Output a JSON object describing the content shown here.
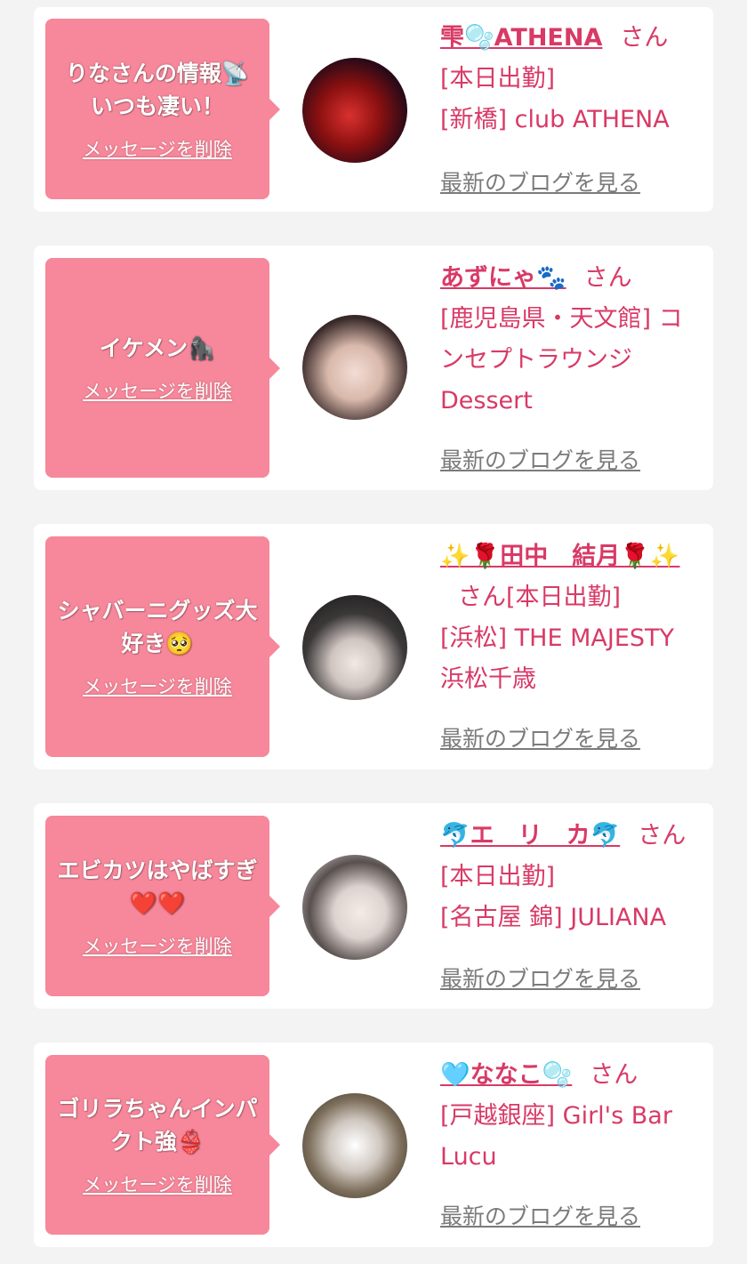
{
  "cards": [
    {
      "message": "りなさんの情報📡いつも凄い！",
      "delete_label": "メッセージを削除",
      "name": "雫🫧ATHENA",
      "san": "さん",
      "status": "[本日出勤]",
      "shop": "[新橋] club ATHENA",
      "blog_label": "最新のブログを見る"
    },
    {
      "message": "イケメン🦍",
      "delete_label": "メッセージを削除",
      "name": "あずにゃ🐾",
      "san": "さん",
      "status": "",
      "shop": "[鹿児島県・天文館] コンセプトラウンジDessert",
      "blog_label": "最新のブログを見る"
    },
    {
      "message": "シャバーニグッズ大好き🥺",
      "delete_label": "メッセージを削除",
      "name": "✨🌹田中　結月🌹✨",
      "san": "さん",
      "status": "[本日出勤]",
      "shop": "[浜松] THE MAJESTY 浜松千歳",
      "blog_label": "最新のブログを見る"
    },
    {
      "message": "エビカツはやばすぎ❤️❤️",
      "delete_label": "メッセージを削除",
      "name": "🐬エ　リ　カ🐬",
      "san": "さん",
      "status": "[本日出勤]",
      "shop": "[名古屋 錦] JULIANA",
      "blog_label": "最新のブログを見る"
    },
    {
      "message": "ゴリラちゃんインパクト強👙",
      "delete_label": "メッセージを削除",
      "name": "🩵ななこ🫧",
      "san": "さん",
      "status": "",
      "shop": "[戸越銀座] Girl's Bar Lucu",
      "blog_label": "最新のブログを見る"
    }
  ],
  "colors": {
    "accent": "#d83a66",
    "message_box": "#f7879a",
    "link_gray": "#7b7b7b",
    "page_bg": "#f3f3f3"
  }
}
